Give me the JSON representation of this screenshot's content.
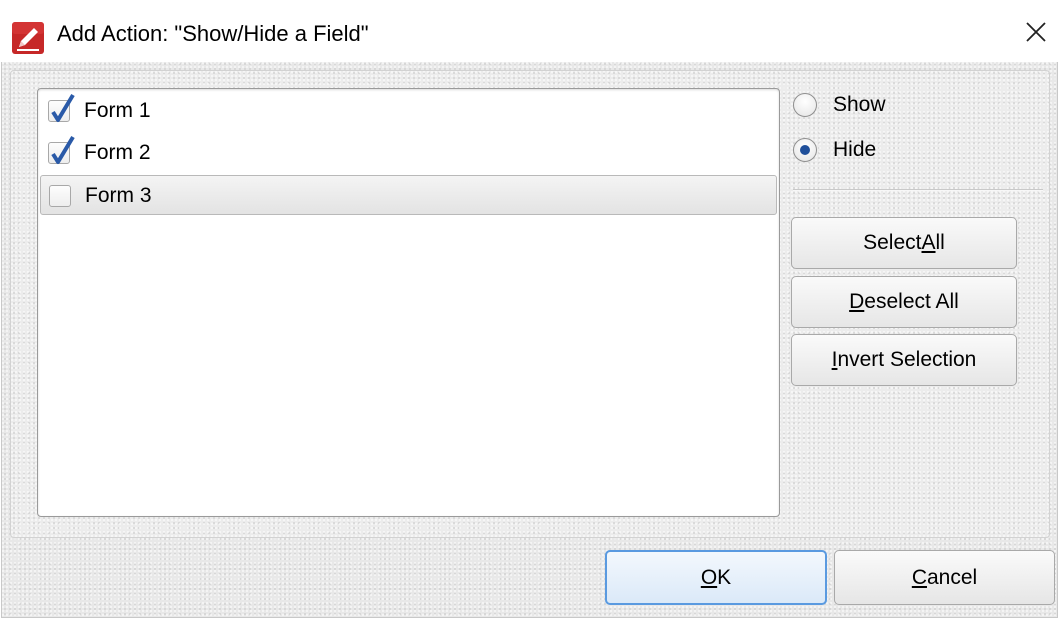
{
  "window": {
    "title": "Add Action: \"Show/Hide a Field\"",
    "icon": "app-pen-icon",
    "close_icon": "close-icon"
  },
  "fields_list": {
    "items": [
      {
        "label": "Form 1",
        "checked": true,
        "selected": false
      },
      {
        "label": "Form 2",
        "checked": true,
        "selected": false
      },
      {
        "label": "Form 3",
        "checked": false,
        "selected": true
      }
    ]
  },
  "visibility": {
    "options": [
      {
        "label": "Show",
        "checked": false
      },
      {
        "label": "Hide",
        "checked": true
      }
    ]
  },
  "actions": {
    "select_all": {
      "prefix": "Select ",
      "mnemonic": "A",
      "suffix": "ll"
    },
    "deselect_all": {
      "prefix": "",
      "mnemonic": "D",
      "suffix": "eselect All"
    },
    "invert_selection": {
      "prefix": "",
      "mnemonic": "I",
      "suffix": "nvert Selection"
    }
  },
  "footer": {
    "ok": {
      "prefix": "",
      "mnemonic": "O",
      "suffix": "K"
    },
    "cancel": {
      "prefix": "",
      "mnemonic": "C",
      "suffix": "ancel"
    }
  },
  "colors": {
    "accent": "#1f4f9a",
    "default_button_border": "#5a9ae0",
    "app_icon_red": "#c62828"
  }
}
